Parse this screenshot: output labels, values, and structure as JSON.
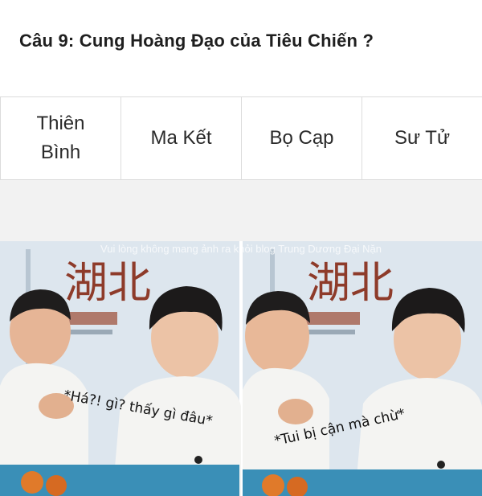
{
  "question": "Câu 9: Cung Hoàng Đạo của Tiêu Chiến ?",
  "options": [
    {
      "label": "Thiên Bình"
    },
    {
      "label": "Ma Kết"
    },
    {
      "label": "Bọ Cạp"
    },
    {
      "label": "Sư Tử"
    }
  ],
  "image": {
    "watermark": "Vui lòng không mang ảnh ra khỏi blog Trung Dương Đại Nặn",
    "caption_left": "*Há?! gì? thấy gì đâu*",
    "caption_right": "*Tui bị cận mà chừ*",
    "poster_characters": "湖北",
    "colors": {
      "background": "#d9e4ec",
      "poster_red": "#9b3b2a",
      "shirt": "#f4f4f2",
      "hair": "#1c1a1a"
    }
  }
}
